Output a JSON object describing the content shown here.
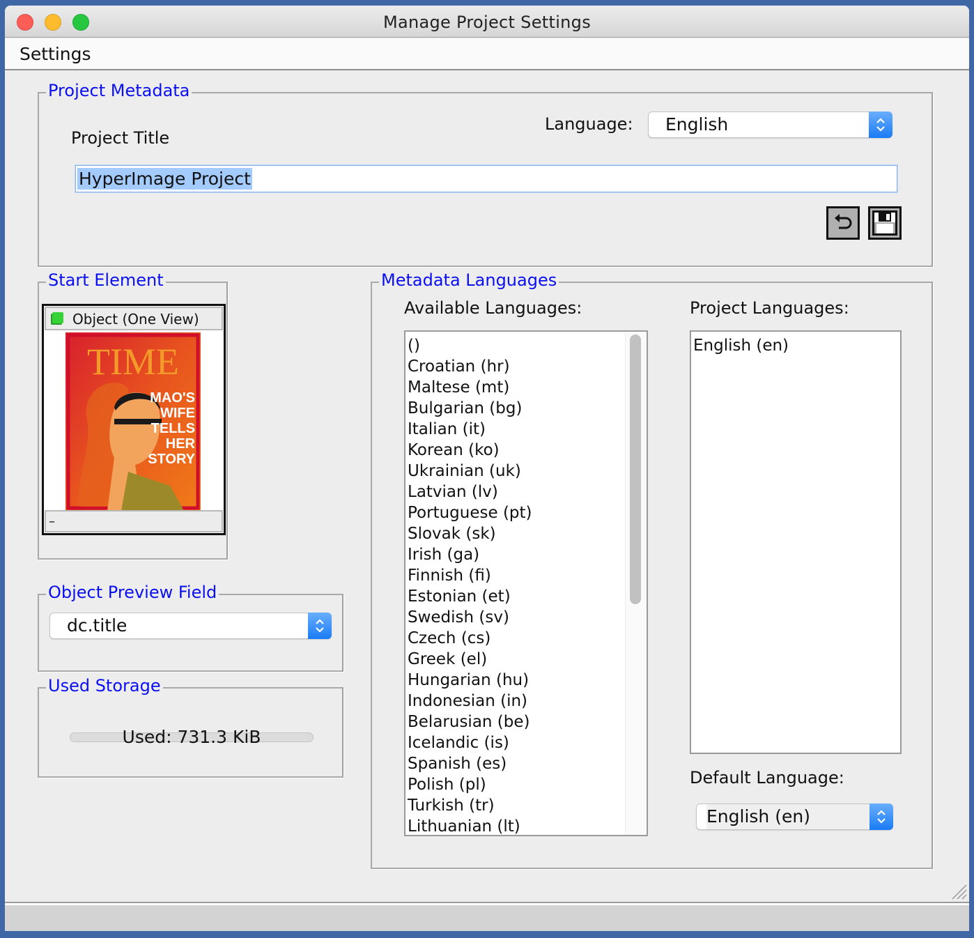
{
  "window": {
    "title": "Manage Project Settings",
    "buttons": [
      "close",
      "minimize",
      "zoom"
    ]
  },
  "menubar": {
    "items": [
      {
        "label": "Settings"
      }
    ]
  },
  "project_metadata": {
    "group_title": "Project Metadata",
    "language_label": "Language:",
    "language_value": "English",
    "project_title_label": "Project Title",
    "project_title_value": "HyperImage Project",
    "revert_icon": "undo-arrow-icon",
    "save_icon": "floppy-disk-icon"
  },
  "start_element": {
    "group_title": "Start Element",
    "element_type_label": "Object (One View)",
    "element_type_icon": "green-object-icon",
    "thumbnail": {
      "description": "TIME magazine cover",
      "masthead": "TIME",
      "headline_lines": [
        "MAO'S",
        "WIFE",
        "TELLS",
        "HER",
        "STORY"
      ]
    },
    "caption": "–"
  },
  "object_preview_field": {
    "group_title": "Object Preview Field",
    "selected_value": "dc.title"
  },
  "used_storage": {
    "group_title": "Used Storage",
    "text": "Used: 731.3 KiB",
    "progress_fraction": 0
  },
  "metadata_languages": {
    "group_title": "Metadata Languages",
    "available_label": "Available Languages:",
    "available": [
      " ()",
      "Croatian (hr)",
      "Maltese (mt)",
      "Bulgarian (bg)",
      "Italian (it)",
      "Korean (ko)",
      "Ukrainian (uk)",
      "Latvian (lv)",
      "Portuguese (pt)",
      "Slovak (sk)",
      "Irish (ga)",
      "Finnish (fi)",
      "Estonian (et)",
      "Swedish (sv)",
      "Czech (cs)",
      "Greek (el)",
      "Hungarian (hu)",
      "Indonesian (in)",
      "Belarusian (be)",
      "Icelandic (is)",
      "Spanish (es)",
      "Polish (pl)",
      "Turkish (tr)",
      "Lithuanian (lt)"
    ],
    "project_label": "Project Languages:",
    "project": [
      "English (en)"
    ],
    "default_label": "Default Language:",
    "default_value": "English (en)"
  },
  "colors": {
    "group_title": "#0b10f0",
    "select_accent": "#1a7cf5",
    "selection_highlight": "#a4cbfe",
    "desktop": "#3f67a6"
  }
}
